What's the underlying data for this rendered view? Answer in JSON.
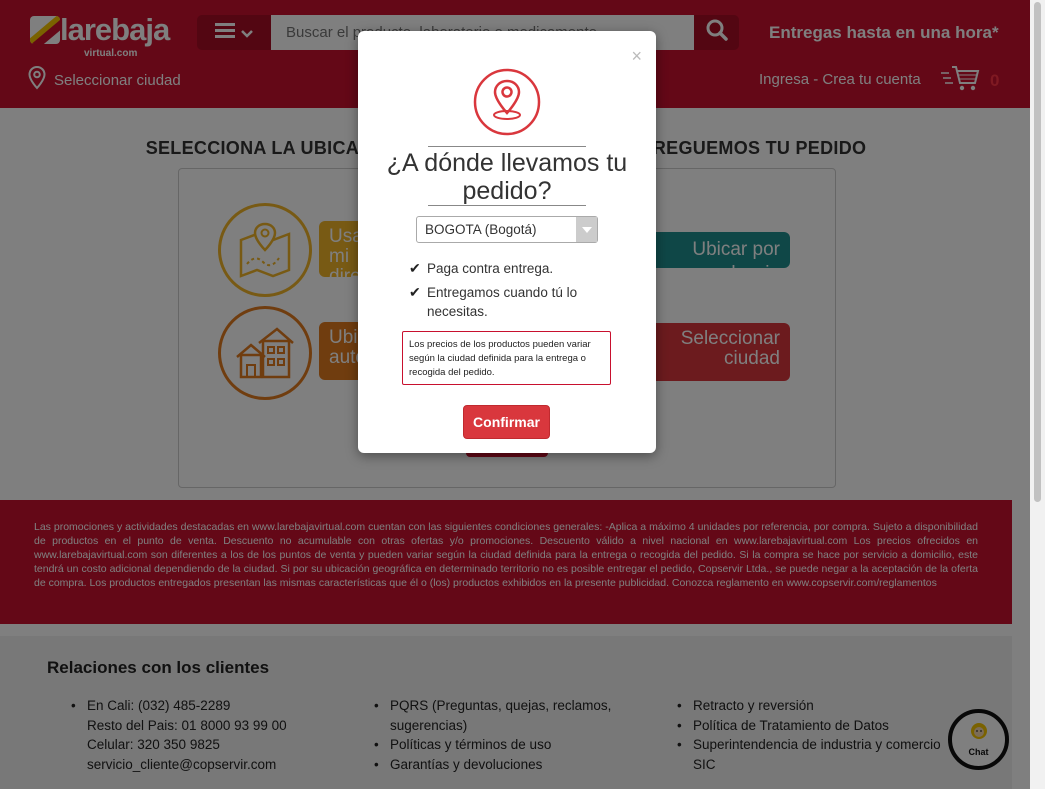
{
  "header": {
    "logo": {
      "brand": "larebaja",
      "sub": "virtual.com"
    },
    "search_placeholder": "Buscar el producto, laboratorio o medicamento",
    "delivery": "Entregas hasta en una hora*",
    "city_select": "Seleccionar ciudad",
    "account": "Ingresa - Crea tu cuenta",
    "cart_count": "0"
  },
  "main": {
    "title": "SELECCIONA LA UBICACIÓN DONDE QUIERES QUE ENTREGUEMOS TU PEDIDO",
    "options": [
      {
        "label": "Usar mi dirección",
        "icon": "map-pin-icon"
      },
      {
        "label": "Ubicar por barrio",
        "icon": ""
      },
      {
        "label": "Ubicar automáticamente",
        "icon": "houses-icon"
      },
      {
        "label": "Seleccionar ciudad",
        "icon": ""
      }
    ]
  },
  "disclaimer": "Las promociones y actividades destacadas en www.larebajavirtual.com cuentan con las siguientes condiciones generales: -Aplica a máximo 4 unidades por referencia, por compra. Sujeto a disponibilidad de productos en el punto de venta. Descuento no acumulable con otras ofertas y/o promociones. Descuento válido a nivel nacional en www.larebajavirtual.com Los precios ofrecidos en www.larebajavirtual.com son diferentes a los de los puntos de venta y pueden variar según la ciudad definida para la entrega o recogida del pedido. Si la compra se hace por servicio a domicilio, este tendrá un costo adicional dependiendo de la ciudad. Si por su ubicación geográfica en determinado territorio no es posible entregar el pedido, Copservir Ltda., se puede negar a la aceptación de la oferta de compra. Los productos entregados presentan las mismas características que él o (los) productos exhibidos en la presente publicidad. Conozca reglamento en www.copservir.com/reglamentos",
  "footer": {
    "title": "Relaciones con los clientes",
    "contact": {
      "cali": "En Cali: (032) 485-2289",
      "resto": "Resto del Pais: 01 8000 93 99 00",
      "celular": "Celular: 320 350 9825",
      "email": "servicio_cliente@copservir.com"
    },
    "col2": [
      "PQRS (Preguntas, quejas, reclamos, sugerencias)",
      "Políticas y términos de uso",
      "Garantías y devoluciones"
    ],
    "col3": [
      "Retracto y reversión",
      "Política de Tratamiento de Datos",
      "Superintendencia de industria y comercio SIC"
    ],
    "chat": "Chat"
  },
  "modal": {
    "close": "×",
    "title": "¿A dónde llevamos tu pedido?",
    "city_value": "BOGOTA (Bogotá)",
    "benefits": [
      "Paga contra entrega.",
      "Entregamos cuando tú lo necesitas."
    ],
    "notice": "Los precios de los productos pueden variar según la ciudad definida para la entrega o recogida del pedido.",
    "confirm": "Confirmar"
  },
  "colors": {
    "brand_red": "#c8102e",
    "teal": "#1f8f8f",
    "orange": "#e07a1f",
    "yellow": "#f0b429"
  }
}
